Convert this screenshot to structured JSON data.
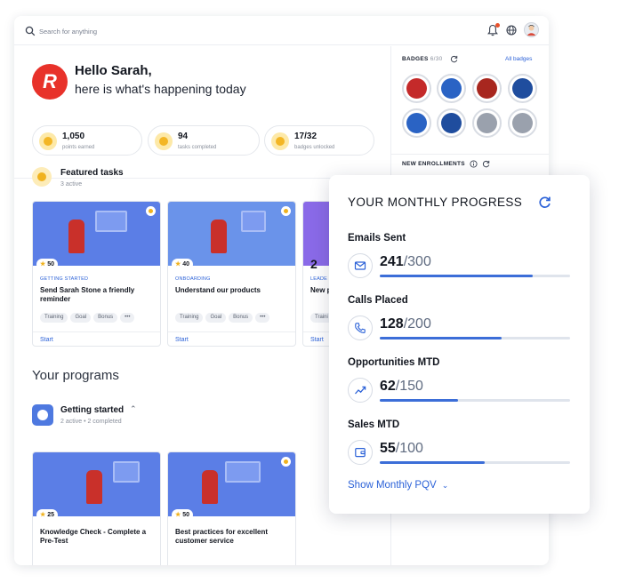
{
  "search": {
    "placeholder": "Search for anything"
  },
  "greeting": {
    "line1": "Hello Sarah,",
    "line2": "here is what's happening today",
    "logo_letter": "R"
  },
  "stats": [
    {
      "value": "1,050",
      "label": "points earned"
    },
    {
      "value": "94",
      "label": "tasks completed"
    },
    {
      "value": "17/32",
      "label": "badges unlocked"
    }
  ],
  "featured": {
    "title": "Featured tasks",
    "subtitle": "3 active",
    "cards": [
      {
        "points": "50",
        "category": "GETTING STARTED",
        "title": "Send Sarah Stone a friendly reminder",
        "tags": [
          "Training",
          "Goal",
          "Bonus",
          "•••"
        ],
        "action": "Start"
      },
      {
        "points": "40",
        "category": "ONBOARDING",
        "title": "Understand our products",
        "tags": [
          "Training",
          "Goal",
          "Bonus",
          "•••"
        ],
        "action": "Start"
      },
      {
        "points": "2",
        "category": "LEADE",
        "title": "New p",
        "tags": [
          "Traini"
        ],
        "action": "Start"
      }
    ]
  },
  "programs": {
    "title": "Your programs",
    "group_title": "Getting started",
    "group_sub": "2 active • 2 completed",
    "cards": [
      {
        "points": "25",
        "title": "Knowledge Check - Complete a Pre-Test"
      },
      {
        "points": "50",
        "title": "Best practices for excellent customer service"
      }
    ]
  },
  "sidebar": {
    "badges_title": "BADGES",
    "badges_count": "6/30",
    "all_badges": "All badges",
    "badges": [
      {
        "name": "stars-badge",
        "color": "#c42a2a"
      },
      {
        "name": "heart-badge",
        "color": "#2a63c4"
      },
      {
        "name": "trophy-badge",
        "color": "#a8271f"
      },
      {
        "name": "camera-badge",
        "color": "#1f4d9e"
      },
      {
        "name": "footprints-badge",
        "color": "#2a63c4"
      },
      {
        "name": "welcome-badge",
        "color": "#1f4d9e"
      },
      {
        "name": "locked-badge",
        "color": "#9aa1ad"
      },
      {
        "name": "locked-badge",
        "color": "#9aa1ad"
      }
    ],
    "enrollments_title": "NEW ENROLLMENTS"
  },
  "progress": {
    "title": "YOUR MONTHLY PROGRESS",
    "metrics": [
      {
        "label": "Emails Sent",
        "value": "241",
        "total": "/300",
        "fraction": 0.803,
        "icon": "mail-icon"
      },
      {
        "label": "Calls Placed",
        "value": "128",
        "total": "/200",
        "fraction": 0.64,
        "icon": "phone-icon"
      },
      {
        "label": "Opportunities MTD",
        "value": "62",
        "total": "/150",
        "fraction": 0.413,
        "icon": "trend-icon"
      },
      {
        "label": "Sales MTD",
        "value": "55",
        "total": "/100",
        "fraction": 0.55,
        "icon": "wallet-icon"
      }
    ],
    "show_link": "Show Monthly PQV"
  },
  "colors": {
    "accent": "#2c62d8",
    "brand": "#e8322a",
    "bar": "#3c6ed8"
  }
}
